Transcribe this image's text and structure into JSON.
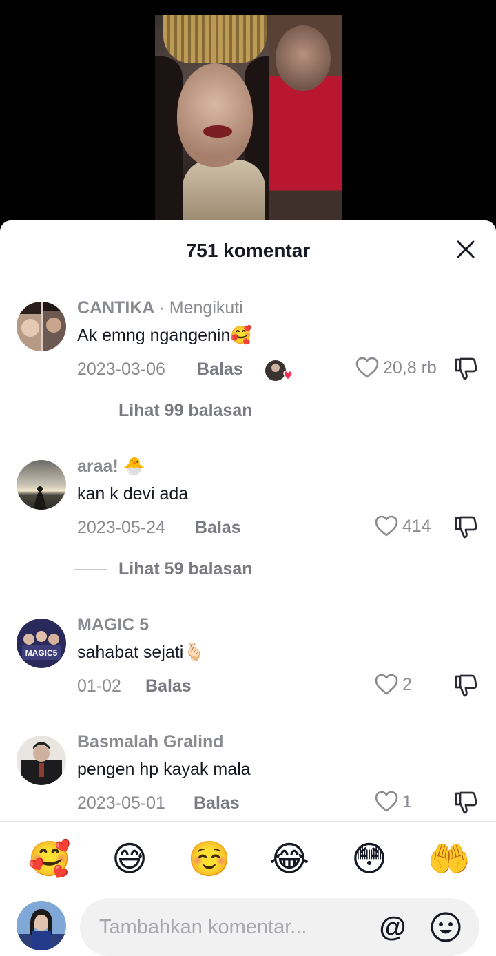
{
  "sheet": {
    "title": "751 komentar",
    "close_icon": "close-icon"
  },
  "comments": [
    {
      "username": "CANTIKA",
      "separator": "·",
      "follow_status": "Mengikuti",
      "text": "Ak emng ngangenin🥰",
      "date": "2023-03-06",
      "reply_label": "Balas",
      "likes": "20,8 rb",
      "creator_liked": true,
      "view_replies": "Lihat 99 balasan"
    },
    {
      "username": "araa! 🐣",
      "text": "kan k devi ada",
      "date": "2023-05-24",
      "reply_label": "Balas",
      "likes": "414",
      "view_replies": "Lihat 59 balasan"
    },
    {
      "username": "MAGIC 5",
      "text": "sahabat sejati🫰🏻",
      "date": "01-02",
      "reply_label": "Balas",
      "likes": "2",
      "avatar_text": "MAGIC5"
    },
    {
      "username": "Basmalah Gralind",
      "text": "pengen hp kayak mala",
      "date": "2023-05-01",
      "reply_label": "Balas",
      "likes": "1"
    }
  ],
  "emoji_bar": [
    "🥰",
    "😅",
    "☺️",
    "😂",
    "😳",
    "🤲"
  ],
  "composer": {
    "placeholder": "Tambahkan komentar...",
    "mention_symbol": "@",
    "emoji_icon": "smiley-icon"
  },
  "colors": {
    "text_primary": "#161823",
    "text_secondary": "#8a8b91",
    "like_heart_red": "#fe2c55",
    "input_bg": "#f1f1f2"
  }
}
